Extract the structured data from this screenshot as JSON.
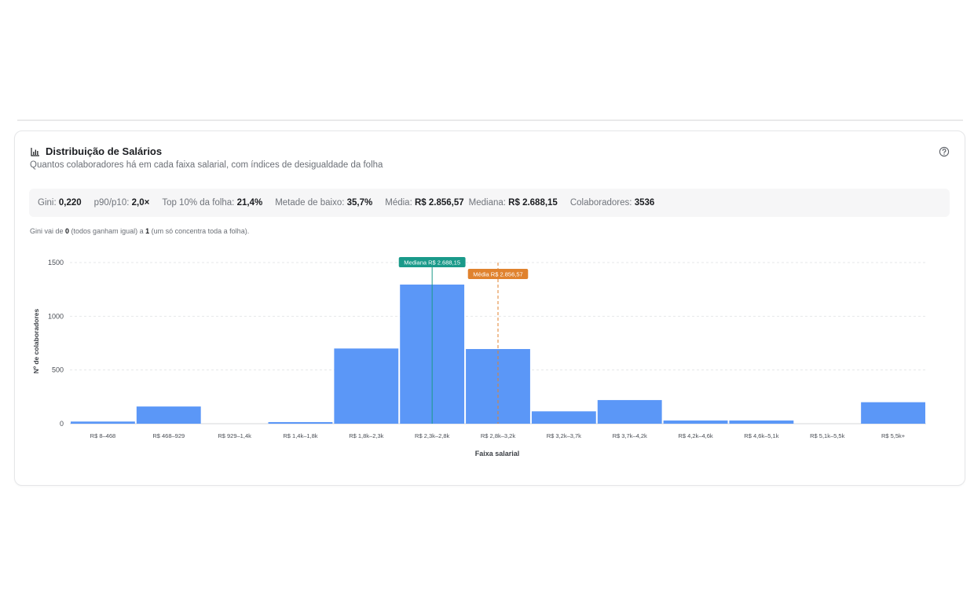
{
  "card": {
    "title": "Distribuição de Salários",
    "subtitle": "Quantos colaboradores há em cada faixa salarial, com índices de desigualdade da folha"
  },
  "icons": {
    "title_icon": "bar-chart-icon",
    "help_icon": "help-circle-icon"
  },
  "stats": [
    {
      "label": "Gini:",
      "value": "0,220"
    },
    {
      "label": "p90/p10:",
      "value": "2,0×"
    },
    {
      "label": "Top 10% da folha:",
      "value": "21,4%"
    },
    {
      "label": "Metade de baixo:",
      "value": "35,7%"
    },
    {
      "label": "Média:",
      "value": "R$ 2.856,57"
    },
    {
      "label": "Mediana:",
      "value": "R$ 2.688,15"
    },
    {
      "label": "Colaboradores:",
      "value": "3536"
    }
  ],
  "gini_note": {
    "prefix": "Gini vai de ",
    "low": "0",
    "mid": " (todos ganham igual) a ",
    "high": "1",
    "suffix": " (um só concentra toda a folha)."
  },
  "colors": {
    "bar": "#5b97f7",
    "median": "#1a9a8a",
    "mean": "#e0822e",
    "grid": "#e6e7e9"
  },
  "chart_data": {
    "type": "bar",
    "xlabel": "Faixa salarial",
    "ylabel": "Nº de colaboradores",
    "ylim": [
      0,
      1500
    ],
    "yticks": [
      0,
      500,
      1000,
      1500
    ],
    "grid": true,
    "categories": [
      "R$ 8–468",
      "R$ 468–929",
      "R$ 929–1,4k",
      "R$ 1,4k–1,8k",
      "R$ 1,8k–2,3k",
      "R$ 2,3k–2,8k",
      "R$ 2,8k–3,2k",
      "R$ 3,2k–3,7k",
      "R$ 3,7k–4,2k",
      "R$ 4,2k–4,6k",
      "R$ 4,6k–5,1k",
      "R$ 5,1k–5,5k",
      "R$ 5,5k+"
    ],
    "values": [
      20,
      160,
      0,
      15,
      700,
      1295,
      695,
      115,
      220,
      30,
      30,
      0,
      200
    ],
    "reference_lines": [
      {
        "label": "Mediana R$ 2.688,15",
        "bin_position": 5.5,
        "style": "solid",
        "color": "#1a9a8a"
      },
      {
        "label": "Média R$ 2.856,57",
        "bin_position": 6.5,
        "style": "dashed",
        "color": "#e0822e"
      }
    ]
  }
}
